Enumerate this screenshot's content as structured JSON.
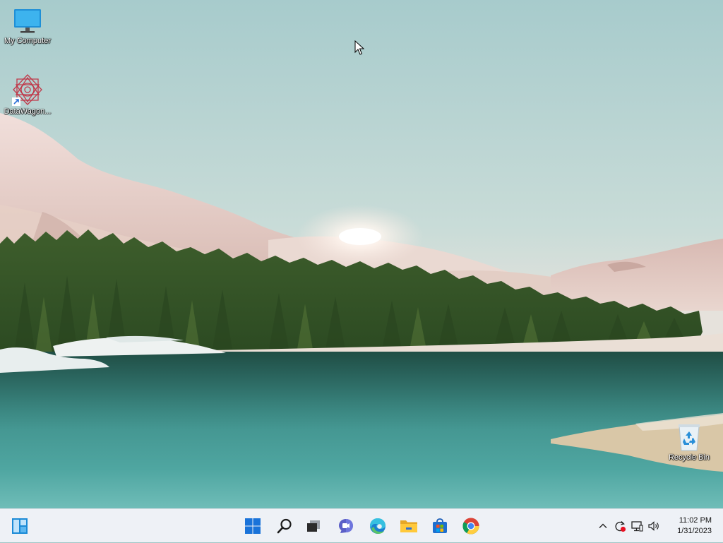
{
  "desktop": {
    "icons": [
      {
        "label": "My Computer",
        "icon": "monitor-icon"
      },
      {
        "label": "DataWagon...",
        "icon": "datawagon-icon"
      },
      {
        "label": "Recycle Bin",
        "icon": "recycle-bin-icon"
      }
    ]
  },
  "taskbar": {
    "left_widget": {
      "icon": "widgets-icon"
    },
    "pinned": [
      {
        "icon": "start-icon"
      },
      {
        "icon": "search-icon"
      },
      {
        "icon": "task-view-icon"
      },
      {
        "icon": "teams-chat-icon"
      },
      {
        "icon": "edge-icon"
      },
      {
        "icon": "file-explorer-icon"
      },
      {
        "icon": "microsoft-store-icon"
      },
      {
        "icon": "chrome-icon"
      }
    ],
    "tray": [
      {
        "icon": "chevron-up-icon"
      },
      {
        "icon": "sync-alert-icon"
      },
      {
        "icon": "network-icon"
      },
      {
        "icon": "volume-icon"
      }
    ],
    "clock": {
      "time": "11:02 PM",
      "date": "1/31/2023"
    }
  },
  "colors": {
    "taskbar_bg": "#eef1f6",
    "start_blue": "#1a73d9",
    "icon_label": "#ffffff"
  }
}
